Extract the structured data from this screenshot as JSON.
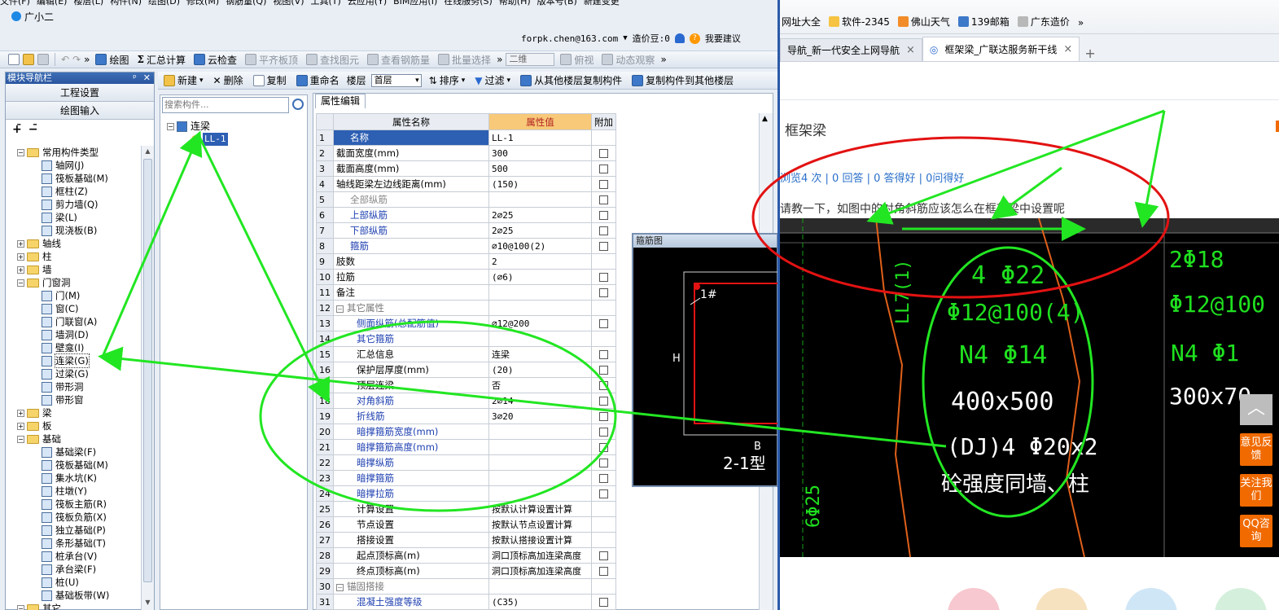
{
  "app": {
    "menu": [
      "文件(F)",
      "编辑(E)",
      "楼层(L)",
      "构件(N)",
      "绘图(D)",
      "修改(M)",
      "钢筋量(Q)",
      "视图(V)",
      "工具(T)",
      "云应用(Y)",
      "BIM应用(I)",
      "在线服务(S)",
      "帮助(H)",
      "版本号(B)",
      "新建变更"
    ],
    "assistant": "广小二",
    "account": "forpk.chen@163.com",
    "price_bean": "造价豆:0",
    "suggest": "我要建议",
    "toolbar1": {
      "draw": "绘图",
      "summary": "汇总计算",
      "cloud_check": "云检查",
      "flat_slab": "平齐板顶",
      "find_element": "查找图元",
      "view_rebar": "查看钢筋量",
      "batch_select": "批量选择",
      "view_mode": "二维",
      "view_angle": "俯视",
      "dynamic": "动态观察"
    },
    "nav": {
      "title": "模块导航栏",
      "project_settings": "工程设置",
      "draw_input": "绘图输入",
      "tree": [
        {
          "label": "常用构件类型",
          "level": 0,
          "folder": true,
          "open": true
        },
        {
          "label": "轴网(J)",
          "level": 1
        },
        {
          "label": "筏板基础(M)",
          "level": 1
        },
        {
          "label": "框柱(Z)",
          "level": 1
        },
        {
          "label": "剪力墙(Q)",
          "level": 1
        },
        {
          "label": "梁(L)",
          "level": 1
        },
        {
          "label": "现浇板(B)",
          "level": 1
        },
        {
          "label": "轴线",
          "level": 0,
          "folder": true,
          "open": false
        },
        {
          "label": "柱",
          "level": 0,
          "folder": true,
          "open": false
        },
        {
          "label": "墙",
          "level": 0,
          "folder": true,
          "open": false
        },
        {
          "label": "门窗洞",
          "level": 0,
          "folder": true,
          "open": true
        },
        {
          "label": "门(M)",
          "level": 1
        },
        {
          "label": "窗(C)",
          "level": 1
        },
        {
          "label": "门联窗(A)",
          "level": 1
        },
        {
          "label": "墙洞(D)",
          "level": 1
        },
        {
          "label": "壁龛(I)",
          "level": 1
        },
        {
          "label": "连梁(G)",
          "level": 1,
          "selected": true
        },
        {
          "label": "过梁(G)",
          "level": 1
        },
        {
          "label": "带形洞",
          "level": 1
        },
        {
          "label": "带形窗",
          "level": 1
        },
        {
          "label": "梁",
          "level": 0,
          "folder": true,
          "open": false
        },
        {
          "label": "板",
          "level": 0,
          "folder": true,
          "open": false
        },
        {
          "label": "基础",
          "level": 0,
          "folder": true,
          "open": true
        },
        {
          "label": "基础梁(F)",
          "level": 1
        },
        {
          "label": "筏板基础(M)",
          "level": 1
        },
        {
          "label": "集水坑(K)",
          "level": 1
        },
        {
          "label": "柱墩(Y)",
          "level": 1
        },
        {
          "label": "筏板主筋(R)",
          "level": 1
        },
        {
          "label": "筏板负筋(X)",
          "level": 1
        },
        {
          "label": "独立基础(P)",
          "level": 1
        },
        {
          "label": "条形基础(T)",
          "level": 1
        },
        {
          "label": "桩承台(V)",
          "level": 1
        },
        {
          "label": "承台梁(F)",
          "level": 1
        },
        {
          "label": "桩(U)",
          "level": 1
        },
        {
          "label": "基础板带(W)",
          "level": 1
        },
        {
          "label": "其它",
          "level": 0,
          "folder": true,
          "open": true
        }
      ]
    },
    "toolbar2": {
      "new": "新建",
      "delete": "删除",
      "copy": "复制",
      "rename": "重命名",
      "floor_label": "楼层",
      "floor_value": "首层",
      "sort": "排序",
      "filter": "过滤",
      "copy_from": "从其他楼层复制构件",
      "copy_to": "复制构件到其他楼层"
    },
    "components": {
      "search_placeholder": "搜索构件...",
      "group": "连梁",
      "item": "LL-1"
    },
    "props": {
      "tab": "属性编辑",
      "headers": {
        "name": "属性名称",
        "value": "属性值",
        "extra": "附加"
      },
      "rows": [
        {
          "n": "1",
          "name": "名称",
          "value": "LL-1",
          "cb": false,
          "style": "sel"
        },
        {
          "n": "2",
          "name": "截面宽度(mm)",
          "value": "300",
          "cb": true
        },
        {
          "n": "3",
          "name": "截面高度(mm)",
          "value": "500",
          "cb": true
        },
        {
          "n": "4",
          "name": "轴线距梁左边线距离(mm)",
          "value": "(150)",
          "cb": true
        },
        {
          "n": "5",
          "name": "全部纵筋",
          "value": "",
          "cb": true,
          "style": "grey"
        },
        {
          "n": "6",
          "name": "上部纵筋",
          "value": "2⌀25",
          "cb": true,
          "style": "blue"
        },
        {
          "n": "7",
          "name": "下部纵筋",
          "value": "2⌀25",
          "cb": true,
          "style": "blue"
        },
        {
          "n": "8",
          "name": "箍筋",
          "value": "⌀10@100(2)",
          "cb": true,
          "style": "blue"
        },
        {
          "n": "9",
          "name": "肢数",
          "value": "2",
          "cb": false
        },
        {
          "n": "10",
          "name": "拉筋",
          "value": "(⌀6)",
          "cb": true
        },
        {
          "n": "11",
          "name": "备注",
          "value": "",
          "cb": true
        },
        {
          "n": "12",
          "name": "其它属性",
          "value": "",
          "cb": false,
          "style": "group"
        },
        {
          "n": "13",
          "name": "侧面纵筋(总配筋值)",
          "value": "⌀12@200",
          "cb": true,
          "style": "blue-indent"
        },
        {
          "n": "14",
          "name": "其它箍筋",
          "value": "",
          "cb": false,
          "style": "blue-indent"
        },
        {
          "n": "15",
          "name": "汇总信息",
          "value": "连梁",
          "cb": true,
          "style": "indent"
        },
        {
          "n": "16",
          "name": "保护层厚度(mm)",
          "value": "(20)",
          "cb": true,
          "style": "indent"
        },
        {
          "n": "17",
          "name": "顶层连梁",
          "value": "否",
          "cb": true,
          "style": "indent"
        },
        {
          "n": "18",
          "name": "对角斜筋",
          "value": "2⌀14",
          "cb": true,
          "style": "blue-indent"
        },
        {
          "n": "19",
          "name": "折线筋",
          "value": "3⌀20",
          "cb": true,
          "style": "blue-indent"
        },
        {
          "n": "20",
          "name": "暗撑箍筋宽度(mm)",
          "value": "",
          "cb": true,
          "style": "blue-indent"
        },
        {
          "n": "21",
          "name": "暗撑箍筋高度(mm)",
          "value": "",
          "cb": true,
          "style": "blue-indent"
        },
        {
          "n": "22",
          "name": "暗撑纵筋",
          "value": "",
          "cb": true,
          "style": "blue-indent"
        },
        {
          "n": "23",
          "name": "暗撑箍筋",
          "value": "",
          "cb": true,
          "style": "blue-indent"
        },
        {
          "n": "24",
          "name": "暗撑拉筋",
          "value": "",
          "cb": true,
          "style": "blue-indent"
        },
        {
          "n": "25",
          "name": "计算设置",
          "value": "按默认计算设置计算",
          "cb": false,
          "style": "indent"
        },
        {
          "n": "26",
          "name": "节点设置",
          "value": "按默认节点设置计算",
          "cb": false,
          "style": "indent"
        },
        {
          "n": "27",
          "name": "搭接设置",
          "value": "按默认搭接设置计算",
          "cb": false,
          "style": "indent"
        },
        {
          "n": "28",
          "name": "起点顶标高(m)",
          "value": "洞口顶标高加连梁高度",
          "cb": true,
          "style": "indent"
        },
        {
          "n": "29",
          "name": "终点顶标高(m)",
          "value": "洞口顶标高加连梁高度",
          "cb": true,
          "style": "indent"
        },
        {
          "n": "30",
          "name": "锚固搭接",
          "value": "",
          "cb": false,
          "style": "group"
        },
        {
          "n": "31",
          "name": "混凝土强度等级",
          "value": "(C35)",
          "cb": true,
          "style": "blue-indent"
        }
      ]
    },
    "rebar_window": {
      "title": "箍筋图",
      "mark": "1#",
      "h_label": "H",
      "b_label": "B",
      "type_label": "2-1型"
    }
  },
  "browser": {
    "bookmarks": [
      "网址大全",
      "软件-2345",
      "佛山天气",
      "139邮箱",
      "广东造价"
    ],
    "tabs": [
      {
        "label": "导航_新一代安全上网导航",
        "active": false
      },
      {
        "label": "框架梁_广联达服务新干线",
        "active": true
      }
    ],
    "page_title": "框架梁",
    "stats": "浏览4 次 | 0 回答 | 0 答得好 | 0问得好",
    "question": "请教一下，如图中的对角斜筋应该怎么在框架梁中设置呢",
    "cad_text": {
      "t1": "4 Φ22",
      "t2": "Φ12@100(4)",
      "t3": "N4 Φ14",
      "t4": "400x500",
      "t5": "(DJ)4 Φ20x2",
      "t6": "砼强度同墙、柱",
      "r1": "2Φ18",
      "r2": "Φ12@100",
      "r3": "N4 Φ1",
      "r4": "300x70",
      "v1": "LL7(1)",
      "v2": "6Φ25"
    },
    "side_buttons": [
      "意见反馈",
      "关注我们",
      "QQ咨询"
    ],
    "top_button": "︿"
  },
  "colors": {
    "annotation_green": "#22e622",
    "annotation_red": "#e31212",
    "accent_orange": "#f06a00",
    "value_header": "#f7c979"
  }
}
